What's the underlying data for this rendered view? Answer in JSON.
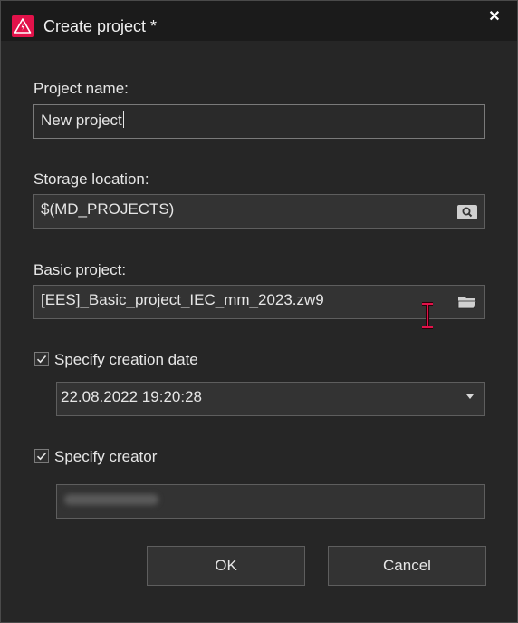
{
  "window": {
    "title": "Create project *",
    "close_glyph": "✕",
    "app_icon": "warning-triangle-icon"
  },
  "form": {
    "project_name": {
      "label": "Project name:",
      "value": "New project"
    },
    "storage_location": {
      "label": "Storage location:",
      "value": "$(MD_PROJECTS)",
      "icon": "browse-search-icon"
    },
    "basic_project": {
      "label": "Basic project:",
      "value": "[EES]_Basic_project_IEC_mm_2023.zw9",
      "icon": "folder-open-icon"
    },
    "creation_date": {
      "label": "Specify creation date",
      "checked": true,
      "value": "22.08.2022 19:20:28"
    },
    "creator": {
      "label": "Specify creator",
      "checked": true,
      "value_obscured": true
    }
  },
  "buttons": {
    "ok": "OK",
    "cancel": "Cancel"
  },
  "colors": {
    "accent": "#e2124a",
    "background": "#262626",
    "titlebar": "#1b1b1b",
    "field": "#333333",
    "border": "#5e5e5e"
  }
}
